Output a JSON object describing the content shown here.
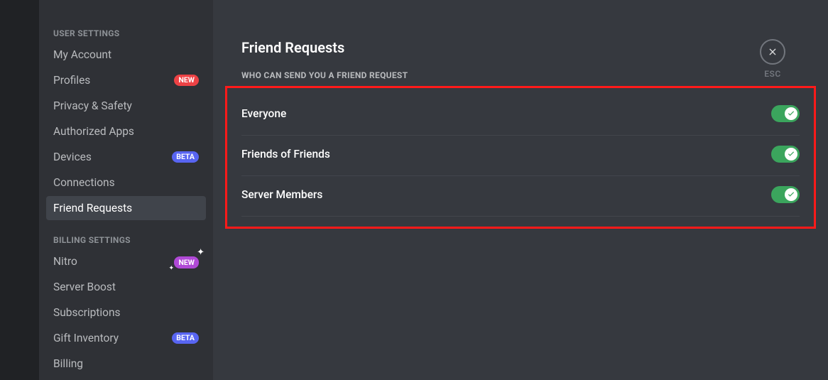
{
  "sidebar": {
    "header_user": "USER SETTINGS",
    "header_billing": "BILLING SETTINGS",
    "items_user": [
      {
        "label": "My Account",
        "badge": null
      },
      {
        "label": "Profiles",
        "badge": "NEW",
        "badge_class": "badge-new"
      },
      {
        "label": "Privacy & Safety",
        "badge": null
      },
      {
        "label": "Authorized Apps",
        "badge": null
      },
      {
        "label": "Devices",
        "badge": "BETA",
        "badge_class": "badge-beta"
      },
      {
        "label": "Connections",
        "badge": null
      },
      {
        "label": "Friend Requests",
        "badge": null,
        "active": true
      }
    ],
    "items_billing": [
      {
        "label": "Nitro",
        "badge": "NEW",
        "badge_class": "badge-nitro-new",
        "sparkle": true
      },
      {
        "label": "Server Boost",
        "badge": null
      },
      {
        "label": "Subscriptions",
        "badge": null
      },
      {
        "label": "Gift Inventory",
        "badge": "BETA",
        "badge_class": "badge-beta"
      },
      {
        "label": "Billing",
        "badge": null
      }
    ]
  },
  "main": {
    "title": "Friend Requests",
    "section_header": "WHO CAN SEND YOU A FRIEND REQUEST",
    "options": [
      {
        "label": "Everyone",
        "enabled": true
      },
      {
        "label": "Friends of Friends",
        "enabled": true
      },
      {
        "label": "Server Members",
        "enabled": true
      }
    ]
  },
  "close": {
    "label": "ESC"
  }
}
